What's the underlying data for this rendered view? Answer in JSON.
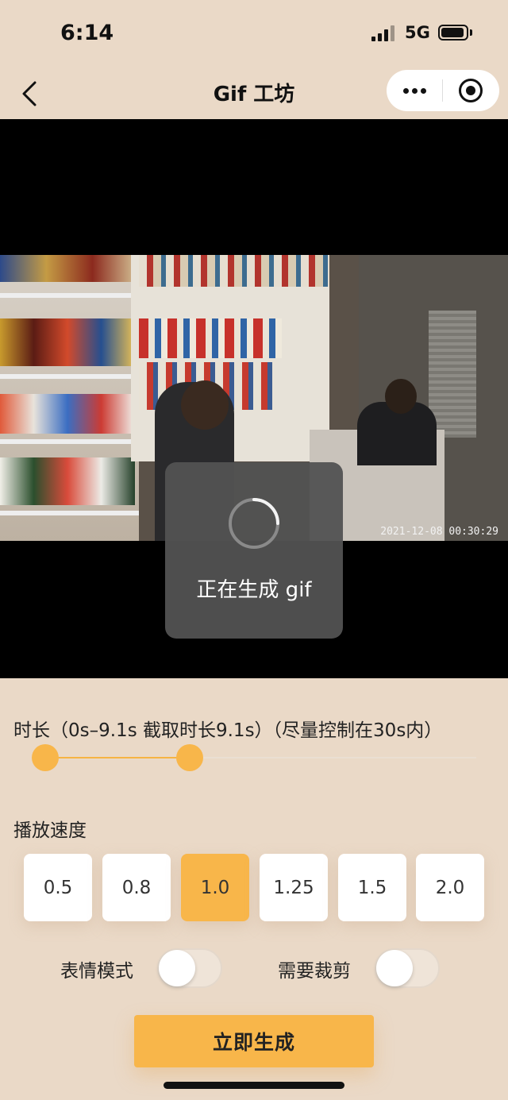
{
  "status_bar": {
    "time": "6:14",
    "network": "5G",
    "signal_level": 0.75,
    "battery_level": 0.85
  },
  "nav": {
    "back_icon": "chevron-left-icon",
    "title": "Gif 工坊",
    "more_icon": "more-dots-icon",
    "target_icon": "target-icon"
  },
  "video": {
    "timestamp": "2021-12-08 00:30:29"
  },
  "loading": {
    "text": "正在生成 gif"
  },
  "duration": {
    "label": "时长（0s–9.1s 截取时长9.1s）（尽量控制在30s内）",
    "range_start_fraction": 0.0,
    "range_end_fraction": 0.33
  },
  "speed": {
    "label": "播放速度",
    "options": [
      "0.5",
      "0.8",
      "1.0",
      "1.25",
      "1.5",
      "2.0"
    ],
    "selected": "1.0"
  },
  "toggles": {
    "emoji_mode_label": "表情模式",
    "emoji_mode_on": false,
    "crop_label": "需要裁剪",
    "crop_on": false
  },
  "generate": {
    "label": "立即生成"
  },
  "colors": {
    "accent": "#f8b64a",
    "background": "#ead9c7",
    "toast": "#525252"
  }
}
